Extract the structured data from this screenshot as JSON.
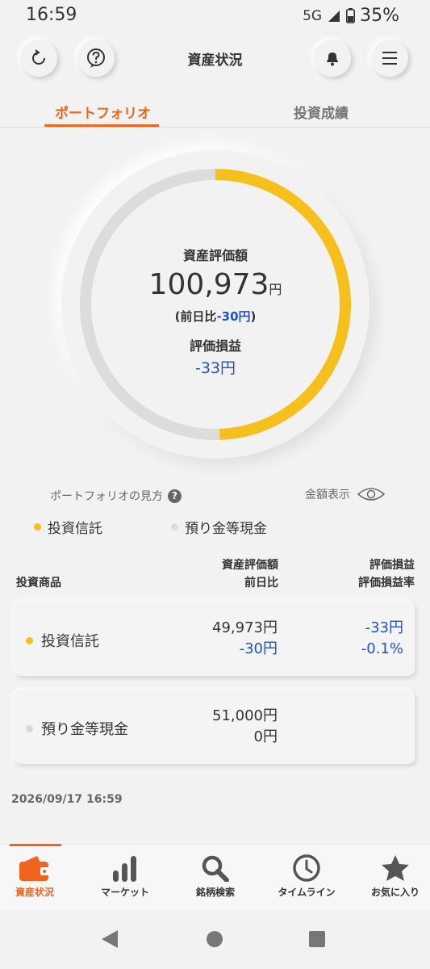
{
  "status_bar": {
    "time": "16:59",
    "network": "5G",
    "battery": "35%"
  },
  "header": {
    "title": "資産状況"
  },
  "tabs": [
    {
      "label": "ポートフォリオ"
    },
    {
      "label": "投資成績"
    }
  ],
  "summary": {
    "label": "資産評価額",
    "value": "100,973",
    "unit": "円",
    "change_prefix": "(前日比",
    "change_value": "-30円",
    "change_suffix": ")",
    "pl_label": "評価損益",
    "pl_value": "-33円"
  },
  "gauge": {
    "segments": [
      {
        "name": "投資信託",
        "value": 49973,
        "color": "#f5c01c"
      },
      {
        "name": "預り金等現金",
        "value": 51000,
        "color": "#dcdcdc"
      }
    ]
  },
  "howto": {
    "label": "ポートフォリオの見方",
    "help": "?"
  },
  "amount_toggle": {
    "label": "金額表示"
  },
  "legend": [
    {
      "label": "投資信託",
      "color": "#f5c01c"
    },
    {
      "label": "預り金等現金",
      "color": "#dcdcdc"
    }
  ],
  "table_header": {
    "product": "投資商品",
    "valuation": "資産評価額",
    "day_change": "前日比",
    "pl": "評価損益",
    "pl_rate": "評価損益率"
  },
  "rows": [
    {
      "name": "投資信託",
      "dot_color": "#f5c01c",
      "valuation": "49,973円",
      "day_change": "-30円",
      "pl": "-33円",
      "pl_rate": "-0.1%"
    },
    {
      "name": "預り金等現金",
      "dot_color": "#d8d8d8",
      "valuation": "51,000円",
      "day_change": "0円",
      "pl": "",
      "pl_rate": ""
    }
  ],
  "timestamp": "2026/09/17 16:59",
  "bottom_nav": [
    {
      "label": "資産状況",
      "icon": "wallet-icon"
    },
    {
      "label": "マーケット",
      "icon": "bar-chart-icon"
    },
    {
      "label": "銘柄検索",
      "icon": "search-icon"
    },
    {
      "label": "タイムライン",
      "icon": "clock-icon"
    },
    {
      "label": "お気に入り",
      "icon": "star-icon"
    }
  ],
  "colors": {
    "accent": "#f0641e",
    "negative": "#2350c8",
    "gauge_fund": "#f5c01c",
    "gauge_cash": "#dcdcdc"
  }
}
